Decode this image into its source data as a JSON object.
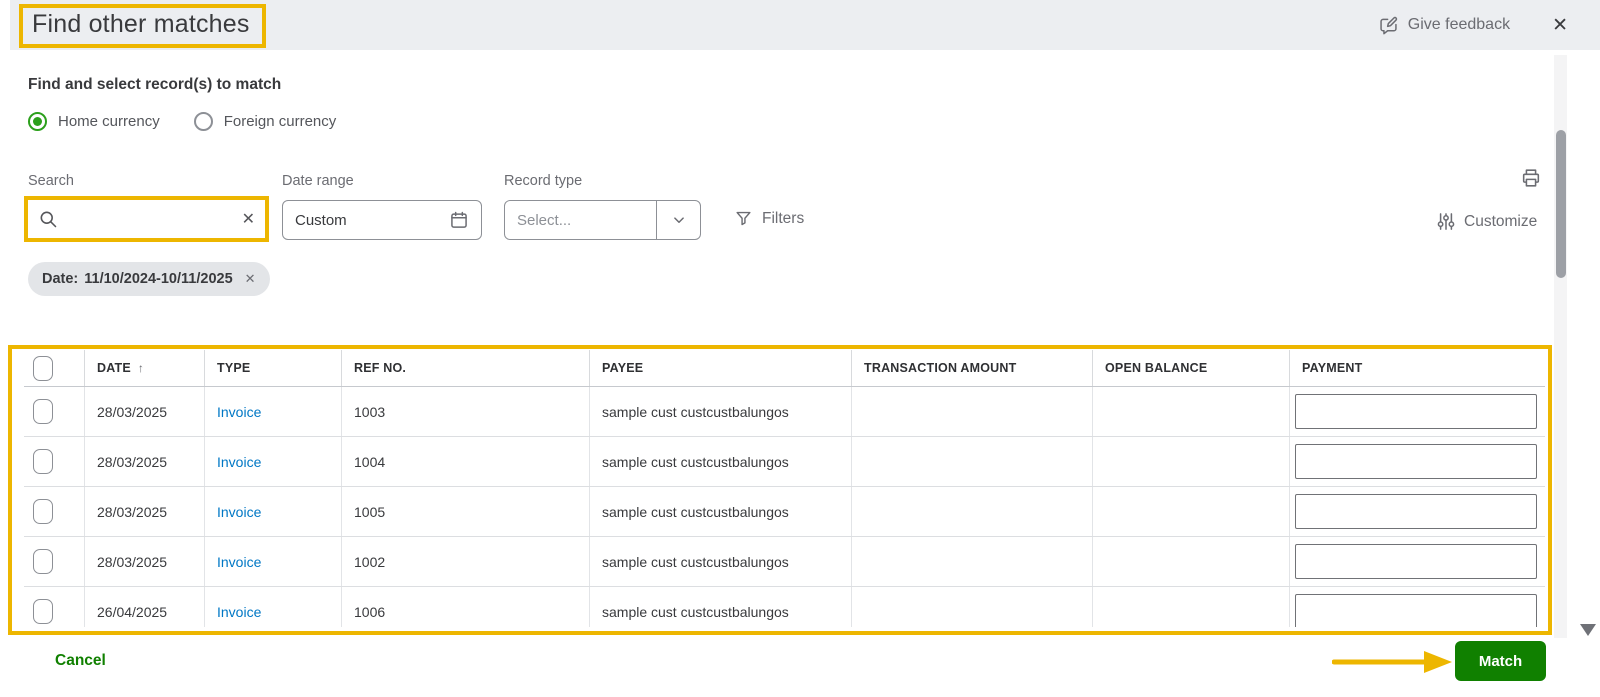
{
  "colors": {
    "highlight_yellow": "#edb600",
    "button_green": "#108000",
    "radio_green": "#2ca01c",
    "link_blue": "#0077c5",
    "header_bg": "#eceef1"
  },
  "icons": {
    "close": "✕",
    "chip_close": "✕",
    "search_clear": "✕",
    "sort_asc": "↑"
  },
  "header": {
    "title": "Find other matches",
    "feedback_label": "Give feedback"
  },
  "intro": {
    "heading": "Find and select record(s) to match",
    "radio_home": "Home currency",
    "radio_foreign": "Foreign currency"
  },
  "controls": {
    "search_label": "Search",
    "search_value": "",
    "search_placeholder": "",
    "date_range_label": "Date range",
    "date_range_value": "Custom",
    "record_type_label": "Record type",
    "record_type_value": "Select...",
    "filters_label": "Filters",
    "customize_label": "Customize",
    "chip_prefix": "Date:",
    "chip_value": "11/10/2024-10/11/2025"
  },
  "table": {
    "columns": [
      "DATE",
      "TYPE",
      "REF NO.",
      "PAYEE",
      "TRANSACTION AMOUNT",
      "OPEN BALANCE",
      "PAYMENT"
    ],
    "sort": {
      "column": "DATE",
      "direction": "asc"
    },
    "rows": [
      {
        "date": "28/03/2025",
        "type": "Invoice",
        "ref_no": "1003",
        "payee": "sample cust custcustbalungos",
        "transaction_amount": "",
        "open_balance": "",
        "payment": ""
      },
      {
        "date": "28/03/2025",
        "type": "Invoice",
        "ref_no": "1004",
        "payee": "sample cust custcustbalungos",
        "transaction_amount": "",
        "open_balance": "",
        "payment": ""
      },
      {
        "date": "28/03/2025",
        "type": "Invoice",
        "ref_no": "1005",
        "payee": "sample cust custcustbalungos",
        "transaction_amount": "",
        "open_balance": "",
        "payment": ""
      },
      {
        "date": "28/03/2025",
        "type": "Invoice",
        "ref_no": "1002",
        "payee": "sample cust custcustbalungos",
        "transaction_amount": "",
        "open_balance": "",
        "payment": ""
      },
      {
        "date": "26/04/2025",
        "type": "Invoice",
        "ref_no": "1006",
        "payee": "sample cust custcustbalungos",
        "transaction_amount": "",
        "open_balance": "",
        "payment": ""
      }
    ]
  },
  "footer": {
    "cancel_label": "Cancel",
    "match_label": "Match"
  }
}
